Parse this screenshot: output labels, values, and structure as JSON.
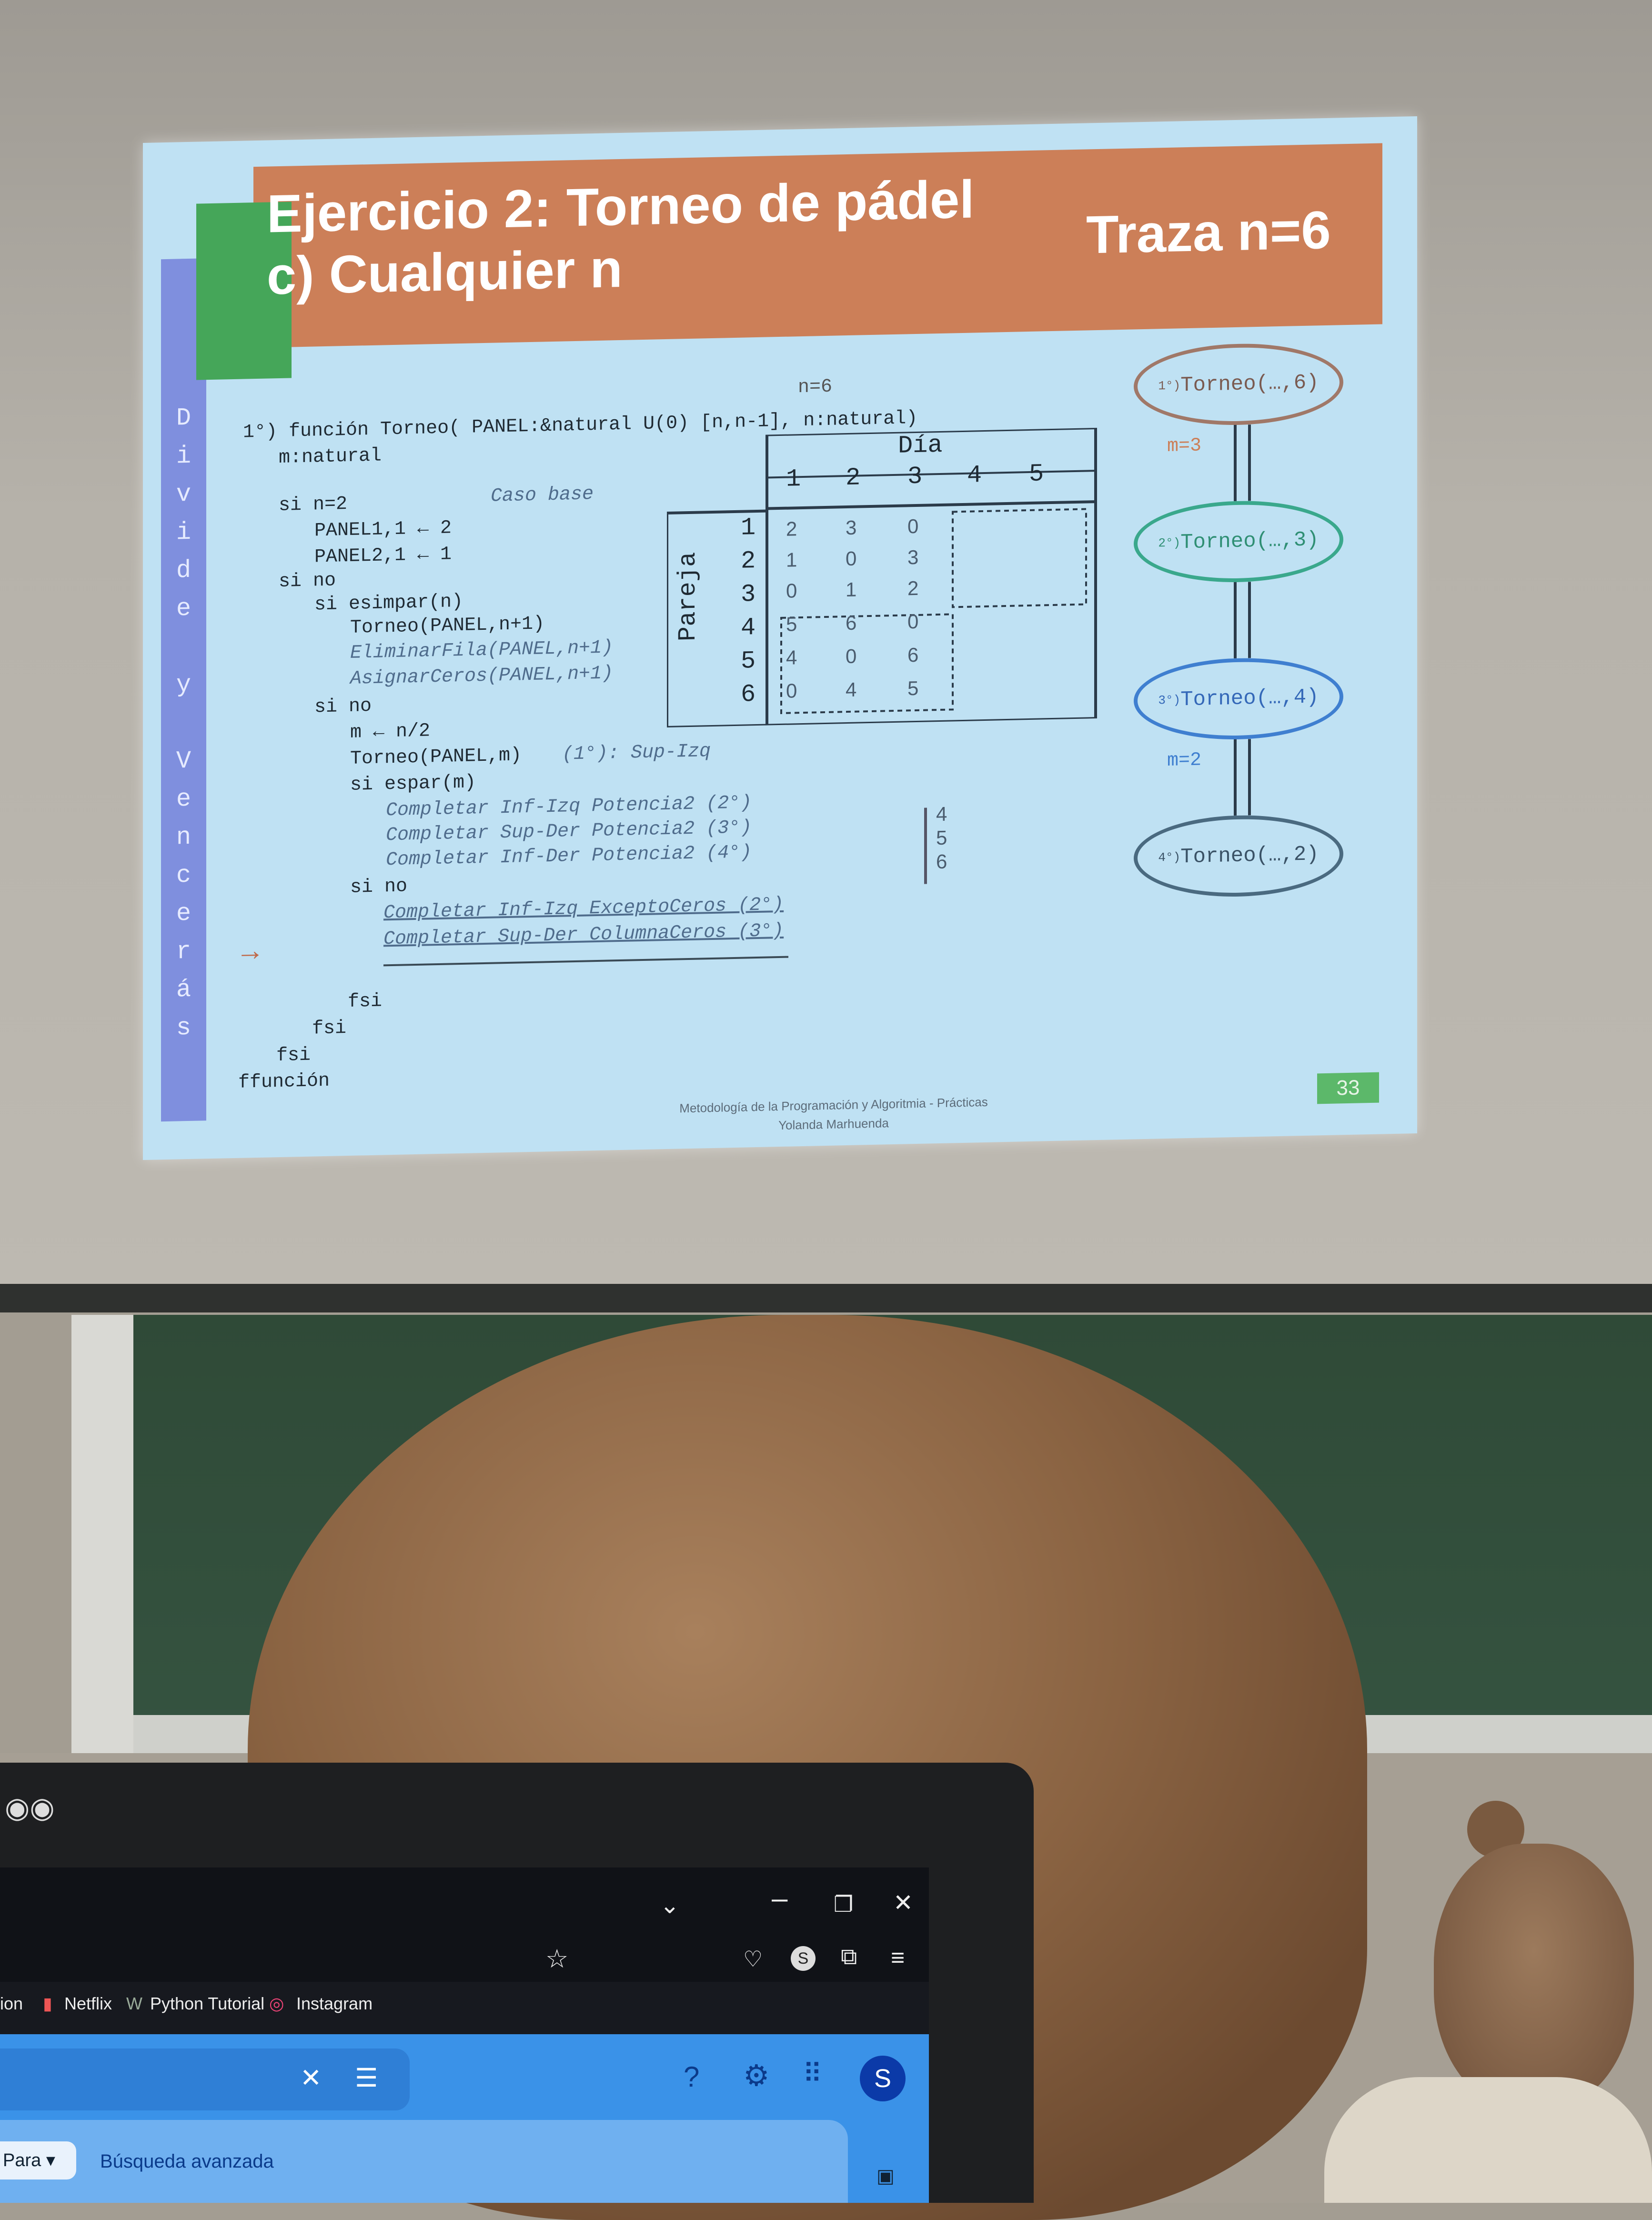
{
  "slide": {
    "title": "Ejercicio 2: Torneo de pádel",
    "subtitle": "c) Cualquier n",
    "trace_label": "Traza n=6",
    "side_letters": [
      "D",
      "i",
      "v",
      "i",
      "d",
      "e",
      "",
      "y",
      "",
      "V",
      "e",
      "n",
      "c",
      "e",
      "r",
      "á",
      "s"
    ],
    "code_lines": [
      {
        "text": "1°) función Torneo( PANEL:&natural U(0) [n,n-1], n:natural)",
        "style": "normal"
      },
      {
        "text": "m:natural",
        "style": "normal"
      },
      {
        "text": "si n=2",
        "style": "normal"
      },
      {
        "text": "Caso base",
        "style": "italic"
      },
      {
        "text": "PANEL1,1 ← 2",
        "style": "normal"
      },
      {
        "text": "PANEL2,1 ← 1",
        "style": "normal"
      },
      {
        "text": "si no",
        "style": "normal"
      },
      {
        "text": "si esimpar(n)",
        "style": "normal"
      },
      {
        "text": "Torneo(PANEL,n+1)",
        "style": "normal"
      },
      {
        "text": "EliminarFila(PANEL,n+1)",
        "style": "italic"
      },
      {
        "text": "AsignarCeros(PANEL,n+1)",
        "style": "italic"
      },
      {
        "text": "si no",
        "style": "normal"
      },
      {
        "text": "m ← n/2",
        "style": "normal"
      },
      {
        "text": "Torneo(PANEL,m)",
        "style": "normal"
      },
      {
        "text": "(1°): Sup-Izq",
        "style": "italic"
      },
      {
        "text": "si espar(m)",
        "style": "normal"
      },
      {
        "text": "Completar Inf-Izq Potencia2 (2°)",
        "style": "italic"
      },
      {
        "text": "Completar Sup-Der Potencia2 (3°)",
        "style": "italic"
      },
      {
        "text": "Completar Inf-Der Potencia2 (4°)",
        "style": "italic"
      },
      {
        "text": "si no",
        "style": "normal"
      },
      {
        "text": "Completar Inf-Izq ExceptoCeros (2°)",
        "style": "italic"
      },
      {
        "text": "Completar Sup-Der ColumnaCeros (3°)",
        "style": "italic"
      },
      {
        "text": "fsi",
        "style": "normal"
      },
      {
        "text": "fsi",
        "style": "normal"
      },
      {
        "text": "fsi",
        "style": "normal"
      },
      {
        "text": "ffunción",
        "style": "normal"
      }
    ],
    "n_label": "n=6",
    "table": {
      "col_header": "Día",
      "row_header": "Pareja",
      "days": [
        "1",
        "2",
        "3",
        "4",
        "5"
      ],
      "pairs": [
        "1",
        "2",
        "3",
        "4",
        "5",
        "6"
      ],
      "cells": [
        [
          "2",
          "3",
          "0"
        ],
        [
          "1",
          "0",
          "3"
        ],
        [
          "0",
          "1",
          "2"
        ],
        [
          "5",
          "6",
          "0"
        ],
        [
          "4",
          "0",
          "6"
        ],
        [
          "0",
          "4",
          "5"
        ]
      ]
    },
    "side_numbers": [
      "4",
      "5",
      "6"
    ],
    "trace": [
      {
        "order": "1°)",
        "label": "Torneo(…,6)",
        "color": "#a07868"
      },
      {
        "order": "2°)",
        "label": "Torneo(…,3)",
        "color": "#3aa88c"
      },
      {
        "order": "3°)",
        "label": "Torneo(…,4)",
        "color": "#3f7fd0"
      },
      {
        "order": "4°)",
        "label": "Torneo(…,2)",
        "color": "#4a6a80"
      }
    ],
    "m_labels": [
      "m=3",
      "m=2"
    ],
    "footer_line1": "Metodología de la Programación y Algoritmia - Prácticas",
    "footer_line2": "Yolanda Marhuenda",
    "page_number": "33"
  },
  "browser": {
    "bookmarks": [
      "ion",
      "Netflix",
      "Python Tutorial",
      "Instagram"
    ],
    "profile_initial": "S",
    "search_filter_label": "Para",
    "advanced_search": "Búsqueda avanzada"
  },
  "colors": {
    "slide_bg": "#bfe1f3",
    "header_orange": "#cc7f58",
    "header_green": "#45a659",
    "side_bar": "#7f8fde",
    "browser_blue": "#3a92e8"
  }
}
